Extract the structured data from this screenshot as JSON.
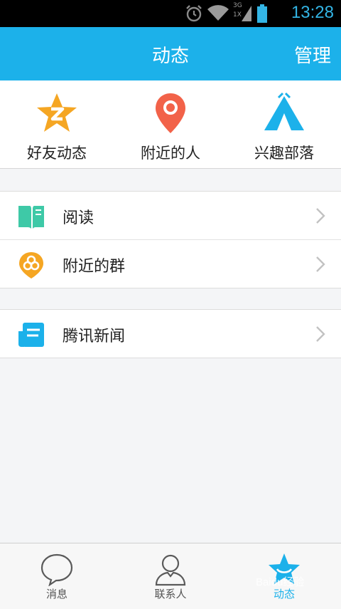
{
  "status_bar": {
    "time": "13:28",
    "network_label": "3G",
    "signal_label": "1X",
    "icons": [
      "alarm-icon",
      "wifi-icon",
      "signal-icon",
      "battery-icon"
    ]
  },
  "header": {
    "title": "动态",
    "manage_label": "管理"
  },
  "quick_entries": [
    {
      "label": "好友动态",
      "icon": "qzone-star-icon",
      "color": "#f5a623"
    },
    {
      "label": "附近的人",
      "icon": "location-pin-icon",
      "color": "#f26249"
    },
    {
      "label": "兴趣部落",
      "icon": "tent-icon",
      "color": "#1cb1ea"
    }
  ],
  "groups": [
    {
      "items": [
        {
          "label": "阅读",
          "icon": "book-icon",
          "color": "#3ec9a7"
        },
        {
          "label": "附近的群",
          "icon": "nearby-group-icon",
          "color": "#f5a623"
        }
      ]
    },
    {
      "items": [
        {
          "label": "腾讯新闻",
          "icon": "news-icon",
          "color": "#1cb1ea"
        }
      ]
    }
  ],
  "tab_bar": {
    "tabs": [
      {
        "label": "消息",
        "icon": "message-bubble-icon"
      },
      {
        "label": "联系人",
        "icon": "contacts-icon"
      },
      {
        "label": "动态",
        "icon": "star-icon",
        "active": true
      }
    ]
  },
  "watermark": "Baidu经验",
  "colors": {
    "accent": "#1cb1ea",
    "status_text": "#33b5e5"
  }
}
